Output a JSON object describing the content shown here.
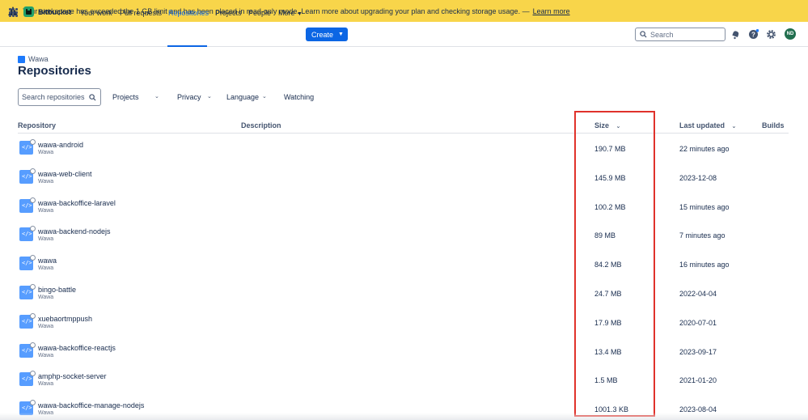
{
  "banner": {
    "message": "Your workspace has exceeded the 1 GB limit and has been placed in read-only mode. Learn more about upgrading your plan and checking storage usage. —",
    "link": "Learn more"
  },
  "nav": {
    "brand": "Bitbucket",
    "links": [
      "Your work",
      "Pull requests",
      "Repositories",
      "Projects",
      "People",
      "More"
    ],
    "active": "Repositories",
    "create_label": "Create",
    "search_placeholder": "Search",
    "avatar_initials": "ND"
  },
  "breadcrumb": "Wawa",
  "title": "Repositories",
  "filters": {
    "search_placeholder": "Search repositories",
    "projects": "Projects",
    "privacy": "Privacy",
    "language": "Language",
    "watching": "Watching"
  },
  "table": {
    "headers": {
      "repository": "Repository",
      "description": "Description",
      "size": "Size",
      "last_updated": "Last updated",
      "builds": "Builds"
    },
    "rows": [
      {
        "name": "wawa-android",
        "project": "Wawa",
        "size": "190.7 MB",
        "updated": "22 minutes ago"
      },
      {
        "name": "wawa-web-client",
        "project": "Wawa",
        "size": "145.9 MB",
        "updated": "2023-12-08"
      },
      {
        "name": "wawa-backoffice-laravel",
        "project": "Wawa",
        "size": "100.2 MB",
        "updated": "15 minutes ago"
      },
      {
        "name": "wawa-backend-nodejs",
        "project": "Wawa",
        "size": "89 MB",
        "updated": "7 minutes ago"
      },
      {
        "name": "wawa",
        "project": "Wawa",
        "size": "84.2 MB",
        "updated": "16 minutes ago"
      },
      {
        "name": "bingo-battle",
        "project": "Wawa",
        "size": "24.7 MB",
        "updated": "2022-04-04"
      },
      {
        "name": "xuebaortmppush",
        "project": "Wawa",
        "size": "17.9 MB",
        "updated": "2020-07-01"
      },
      {
        "name": "wawa-backoffice-reactjs",
        "project": "Wawa",
        "size": "13.4 MB",
        "updated": "2023-09-17"
      },
      {
        "name": "amphp-socket-server",
        "project": "Wawa",
        "size": "1.5 MB",
        "updated": "2021-01-20"
      },
      {
        "name": "wawa-backoffice-manage-nodejs",
        "project": "Wawa",
        "size": "1001.3 KB",
        "updated": "2023-08-04"
      }
    ]
  },
  "colors": {
    "banner": "#f8d54a",
    "primary": "#0c66e4",
    "highlight": "#e0322b",
    "repo_icon": "#579dff"
  }
}
